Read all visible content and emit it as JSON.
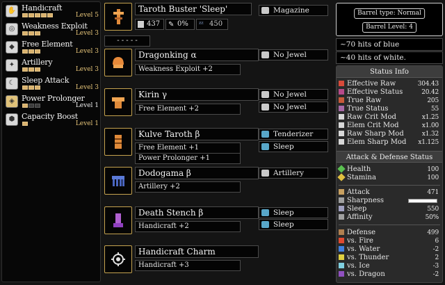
{
  "skills": [
    {
      "name": "Handicraft",
      "level": "Level 5",
      "pips": 5,
      "filled": 5,
      "icon": "craft-hand-icon"
    },
    {
      "name": "Weakness Exploit",
      "level": "Level 3",
      "pips": 3,
      "filled": 3,
      "icon": "weakness-icon"
    },
    {
      "name": "Free Element",
      "level": "Level 3",
      "pips": 3,
      "filled": 3,
      "icon": "element-icon"
    },
    {
      "name": "Artillery",
      "level": "Level 3",
      "pips": 3,
      "filled": 3,
      "icon": "artillery-icon"
    },
    {
      "name": "Sleep Attack",
      "level": "Level 3",
      "pips": 3,
      "filled": 3,
      "icon": "sleep-icon"
    },
    {
      "name": "Power Prolonger",
      "level": "Level 1",
      "pips": 3,
      "filled": 1,
      "icon": "prolonger-icon"
    },
    {
      "name": "Capacity Boost",
      "level": "Level 1",
      "pips": 1,
      "filled": 1,
      "icon": "capacity-icon"
    }
  ],
  "weapon": {
    "name": "Taroth Buster 'Sleep'",
    "defense": "437",
    "affinity": "0%",
    "element_value": "450",
    "slot": "Magazine",
    "empty_label": "- - - - -"
  },
  "armor": [
    {
      "name": "Dragonking α",
      "skills": [
        "Weakness Exploit +2"
      ],
      "slots": [
        "No Jewel"
      ]
    },
    {
      "name": "Kirin γ",
      "skills": [
        "Free Element +2"
      ],
      "slots": [
        "No Jewel",
        "No Jewel"
      ]
    },
    {
      "name": "Kulve Taroth β",
      "skills": [
        "Free Element +1",
        "Power Prolonger +1"
      ],
      "slots": [
        "Tenderizer",
        "Sleep"
      ]
    },
    {
      "name": "Dodogama β",
      "skills": [
        "Artillery +2"
      ],
      "slots": [
        "Artillery"
      ]
    },
    {
      "name": "Death Stench β",
      "skills": [
        "Handicraft +2"
      ],
      "slots": [
        "Sleep",
        "Sleep"
      ]
    },
    {
      "name": "Handicraft Charm",
      "skills": [
        "Handicraft +3"
      ],
      "slots": []
    }
  ],
  "barrel": {
    "type": "Barrel type: Normal",
    "level": "Barrel Level: 4",
    "notes": [
      "~70 hits of blue",
      "~40 hits of white."
    ]
  },
  "status": {
    "header": "Status Info",
    "rows": [
      {
        "label": "Effective Raw",
        "value": "304.43"
      },
      {
        "label": "Effective Status",
        "value": "20.42"
      },
      {
        "label": "True Raw",
        "value": "205"
      },
      {
        "label": "True Status",
        "value": "55"
      },
      {
        "label": "Raw Crit Mod",
        "value": "x1.25"
      },
      {
        "label": "Elem Crit Mod",
        "value": "x1.00"
      },
      {
        "label": "Raw Sharp Mod",
        "value": "x1.32"
      },
      {
        "label": "Elem Sharp Mod",
        "value": "x1.125"
      }
    ],
    "ad_header": "Attack & Defense Status",
    "vitals": [
      {
        "label": "Health",
        "value": "100"
      },
      {
        "label": "Stamina",
        "value": "100"
      }
    ],
    "attack": [
      {
        "label": "Attack",
        "value": "471"
      },
      {
        "label": "Sharpness",
        "value": ""
      },
      {
        "label": "Sleep",
        "value": "550"
      },
      {
        "label": "Affinity",
        "value": "50%"
      }
    ],
    "defense": [
      {
        "label": "Defense",
        "value": "499"
      },
      {
        "label": "vs. Fire",
        "value": "6"
      },
      {
        "label": "vs. Water",
        "value": "-2"
      },
      {
        "label": "vs. Thunder",
        "value": "2"
      },
      {
        "label": "vs. Ice",
        "value": "-3"
      },
      {
        "label": "vs. Dragon",
        "value": "-2"
      }
    ]
  },
  "colors": {
    "gold": "#c6a34f",
    "pip": "#d9b16d",
    "jewel_blue": "#58a7c9"
  }
}
